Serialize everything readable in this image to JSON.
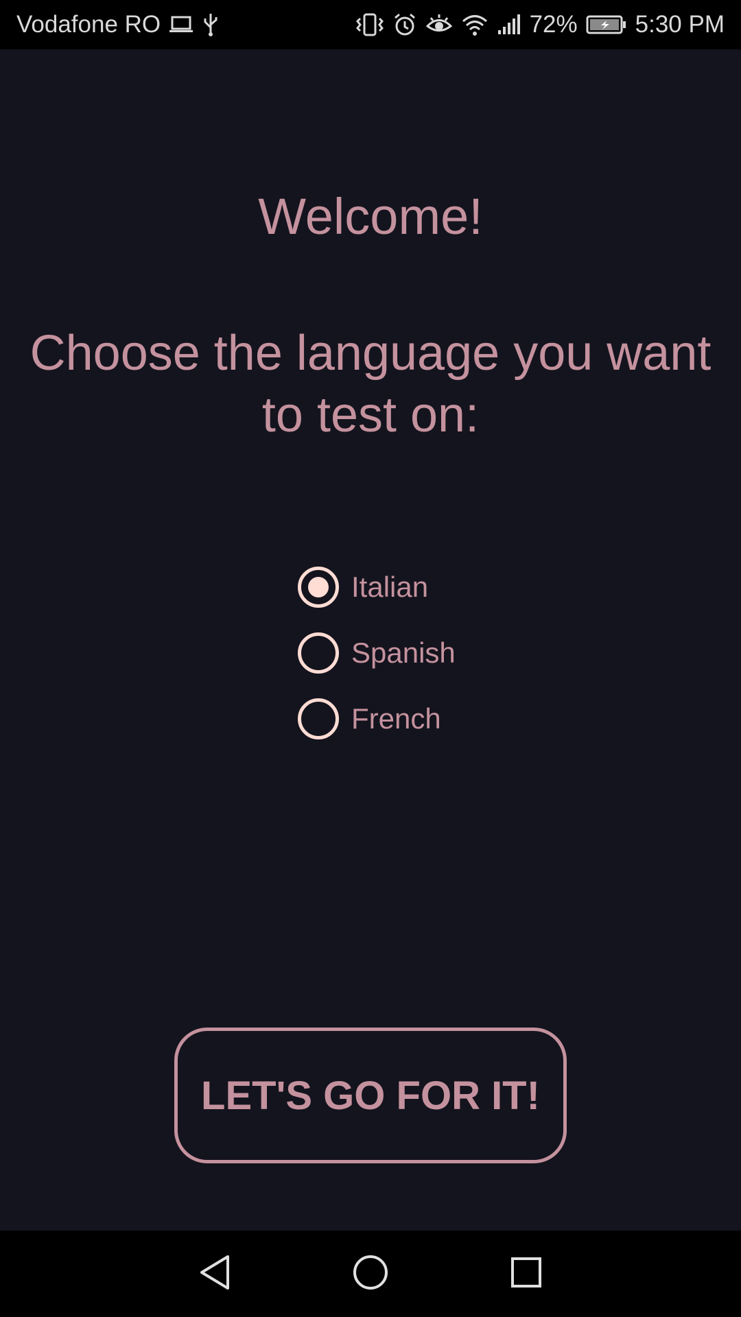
{
  "status_bar": {
    "carrier": "Vodafone RO",
    "battery": "72%",
    "time": "5:30 PM"
  },
  "main": {
    "welcome": "Welcome!",
    "prompt": "Choose the language you want to test on:",
    "languages": [
      {
        "label": "Italian",
        "selected": true
      },
      {
        "label": "Spanish",
        "selected": false
      },
      {
        "label": "French",
        "selected": false
      }
    ],
    "button_label": "LET'S GO FOR IT!"
  },
  "colors": {
    "background": "#14141e",
    "accent": "#c4929e",
    "radio": "#ffdcd4"
  },
  "icons": {
    "status_left": [
      "laptop-icon",
      "usb-icon"
    ],
    "status_right": [
      "vibrate-icon",
      "alarm-icon",
      "eye-icon",
      "wifi-icon",
      "signal-icon",
      "battery-icon"
    ],
    "nav": [
      "back-icon",
      "home-icon",
      "recents-icon"
    ]
  }
}
